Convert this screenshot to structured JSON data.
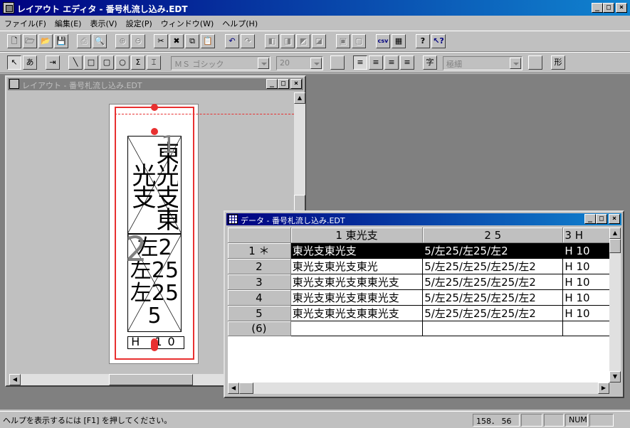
{
  "window": {
    "title": "レイアウト エディタ - 番号札流し込み.EDT"
  },
  "caption_buttons": {
    "minimize": "_",
    "maximize": "□",
    "close": "×"
  },
  "menu": [
    "ファイル(F)",
    "編集(E)",
    "表示(V)",
    "設定(P)",
    "ウィンドウ(W)",
    "ヘルプ(H)"
  ],
  "toolbar1": {
    "buttons": [
      {
        "name": "new",
        "glyph": "🗋"
      },
      {
        "name": "open-template",
        "glyph": "🗁"
      },
      {
        "name": "open",
        "glyph": "📂"
      },
      {
        "name": "save",
        "glyph": "💾"
      },
      {
        "name": "print",
        "glyph": "⎙"
      },
      {
        "name": "print-preview",
        "glyph": "🔍"
      },
      {
        "name": "zoom-in",
        "glyph": "⊕"
      },
      {
        "name": "zoom-out",
        "glyph": "⊖"
      },
      {
        "name": "cut",
        "glyph": "✂"
      },
      {
        "name": "delete",
        "glyph": "✖"
      },
      {
        "name": "copy",
        "glyph": "⧉"
      },
      {
        "name": "paste",
        "glyph": "📋"
      },
      {
        "name": "undo",
        "glyph": "↶"
      },
      {
        "name": "redo",
        "glyph": "↷"
      },
      {
        "name": "bring-front",
        "glyph": "◧"
      },
      {
        "name": "send-back",
        "glyph": "◨"
      },
      {
        "name": "forward",
        "glyph": "◩"
      },
      {
        "name": "backward",
        "glyph": "◪"
      },
      {
        "name": "group",
        "glyph": "▣"
      },
      {
        "name": "ungroup",
        "glyph": "▢"
      },
      {
        "name": "csv",
        "glyph": "csv"
      },
      {
        "name": "data-table",
        "glyph": "▦"
      },
      {
        "name": "help",
        "glyph": "?"
      },
      {
        "name": "context-help",
        "glyph": "↖?"
      }
    ]
  },
  "toolbar2": {
    "buttons": [
      {
        "name": "select",
        "glyph": "↖"
      },
      {
        "name": "text-tool",
        "glyph": "あ"
      },
      {
        "name": "field-tool",
        "glyph": "⇥"
      },
      {
        "name": "line",
        "glyph": "╲"
      },
      {
        "name": "rect",
        "glyph": "□"
      },
      {
        "name": "rounded-rect",
        "glyph": "▢"
      },
      {
        "name": "ellipse",
        "glyph": "○"
      },
      {
        "name": "sigma",
        "glyph": "Σ"
      },
      {
        "name": "barcode",
        "glyph": "⌶"
      }
    ],
    "font_name": "ＭＳ ゴシック",
    "font_size": "20",
    "weight": "極細",
    "align_buttons": [
      "≡",
      "≡",
      "≡",
      "≡"
    ],
    "char_button": "字",
    "shape_button": "形"
  },
  "layout_window": {
    "title": "レイアウト - 番号札流し込み.EDT",
    "field1_text": "東光支東光支",
    "field1_overlay": "1",
    "field2_text": "左2左25左255",
    "field2_overlay": "2",
    "field3_text": "H 10"
  },
  "data_window": {
    "title": "データ - 番号札流し込み.EDT",
    "columns": [
      "1 東光支",
      "2 5",
      "3 H"
    ],
    "rows": [
      {
        "num": "1 ＊",
        "c1": "東光支東光支",
        "c2": "5/左25/左25/左2",
        "c3": "H 10"
      },
      {
        "num": "2",
        "c1": "東光支東光支東光",
        "c2": "5/左25/左25/左25/左2",
        "c3": "H 10"
      },
      {
        "num": "3",
        "c1": "東光支東光支東東光支",
        "c2": "5/左25/左25/左25/左2",
        "c3": "H 10"
      },
      {
        "num": "4",
        "c1": "東光支東光支東東光支",
        "c2": "5/左25/左25/左25/左2",
        "c3": "H 10"
      },
      {
        "num": "5",
        "c1": "東光支東光支東東光支",
        "c2": "5/左25/左25/左25/左2",
        "c3": "H 10"
      },
      {
        "num": "(6)",
        "c1": "",
        "c2": "",
        "c3": ""
      }
    ]
  },
  "statusbar": {
    "message": "ヘルプを表示するには [F1] を押してください。",
    "coords": "158． 56",
    "num": "NUM"
  }
}
